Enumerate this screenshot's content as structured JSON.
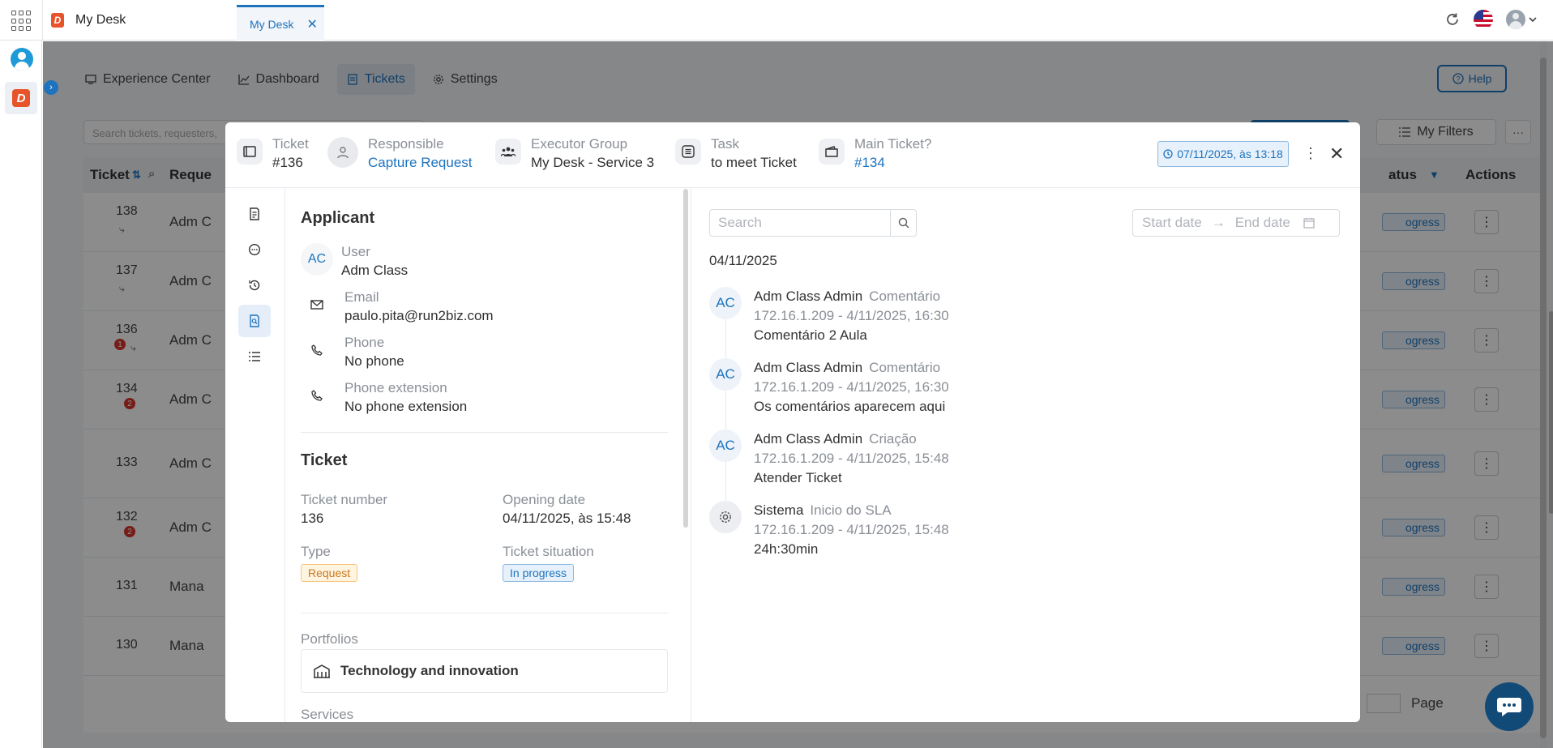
{
  "topbar": {
    "app_title": "My Desk",
    "active_tab": "My Desk",
    "close_glyph": "✕"
  },
  "nav": {
    "items": [
      {
        "label": "Experience Center"
      },
      {
        "label": "Dashboard"
      },
      {
        "label": "Tickets"
      },
      {
        "label": "Settings"
      }
    ],
    "help_label": "Help"
  },
  "background": {
    "search_placeholder": "Search tickets, requesters,",
    "filters_label": "My Filters",
    "more_label": "···",
    "columns": {
      "ticket": "Ticket",
      "requester": "Reque",
      "status": "atus",
      "actions": "Actions"
    },
    "rows": [
      {
        "number": "138",
        "requester": "Adm C",
        "status": "ogress"
      },
      {
        "number": "137",
        "requester": "Adm C",
        "status": "ogress"
      },
      {
        "number": "136",
        "requester": "Adm C",
        "status": "ogress",
        "badge": "1"
      },
      {
        "number": "134",
        "requester": "Adm C",
        "status": "ogress",
        "badge": "2"
      },
      {
        "number": "133",
        "requester": "Adm C",
        "status": "ogress"
      },
      {
        "number": "132",
        "requester": "Adm C",
        "status": "ogress",
        "badge": "2"
      },
      {
        "number": "131",
        "requester": "Mana",
        "status": "ogress"
      },
      {
        "number": "130",
        "requester": "Mana",
        "status": "ogress"
      }
    ],
    "page_label": "Page"
  },
  "modal": {
    "header": {
      "ticket_label": "Ticket",
      "ticket_value": "#136",
      "responsible_label": "Responsible",
      "responsible_value": "Capture Request",
      "executor_label": "Executor Group",
      "executor_value": "My Desk - Service 3",
      "task_label": "Task",
      "task_value": "to meet Ticket",
      "main_label": "Main Ticket?",
      "main_value": "#134",
      "date_badge": "07/11/2025, às 13:18"
    },
    "applicant": {
      "title": "Applicant",
      "user_initials": "AC",
      "user_label": "User",
      "user_value": "Adm Class",
      "email_label": "Email",
      "email_value": "paulo.pita@run2biz.com",
      "phone_label": "Phone",
      "phone_value": "No phone",
      "ext_label": "Phone extension",
      "ext_value": "No phone extension"
    },
    "ticket": {
      "title": "Ticket",
      "number_label": "Ticket number",
      "number_value": "136",
      "opening_label": "Opening date",
      "opening_value": "04/11/2025, às 15:48",
      "type_label": "Type",
      "type_value": "Request",
      "situation_label": "Ticket situation",
      "situation_value": "In progress",
      "portfolios_label": "Portfolios",
      "portfolio_value": "Technology and innovation",
      "services_label": "Services"
    },
    "timeline": {
      "search_placeholder": "Search",
      "start_placeholder": "Start date",
      "end_placeholder": "End date",
      "arrow": "→",
      "day": "04/11/2025",
      "entries": [
        {
          "initials": "AC",
          "who": "Adm Class Admin",
          "kind": "Comentário",
          "meta": "172.16.1.209 -  4/11/2025, 16:30",
          "text": "Comentário 2 Aula"
        },
        {
          "initials": "AC",
          "who": "Adm Class Admin",
          "kind": "Comentário",
          "meta": "172.16.1.209 -  4/11/2025, 16:30",
          "text": "Os comentários aparecem aqui"
        },
        {
          "initials": "AC",
          "who": "Adm Class Admin",
          "kind": "Criação",
          "meta": "172.16.1.209 -  4/11/2025, 15:48",
          "text": "Atender Ticket"
        },
        {
          "initials": "",
          "who": "Sistema",
          "kind": "Inicio do SLA",
          "meta": "172.16.1.209 -  4/11/2025, 15:48",
          "text": "24h:30min"
        }
      ]
    }
  },
  "icons": {
    "apps": "grid-icon",
    "refresh": "refresh-icon",
    "flag": "us-flag-icon",
    "avatar": "user-avatar-icon",
    "chat": "chat-icon",
    "close": "close-icon",
    "kebab": "kebab-icon",
    "clock": "clock-icon"
  },
  "colors": {
    "accent": "#1e73be",
    "brand": "#e8542a",
    "overlay": "#000000",
    "chat": "#124a77"
  }
}
